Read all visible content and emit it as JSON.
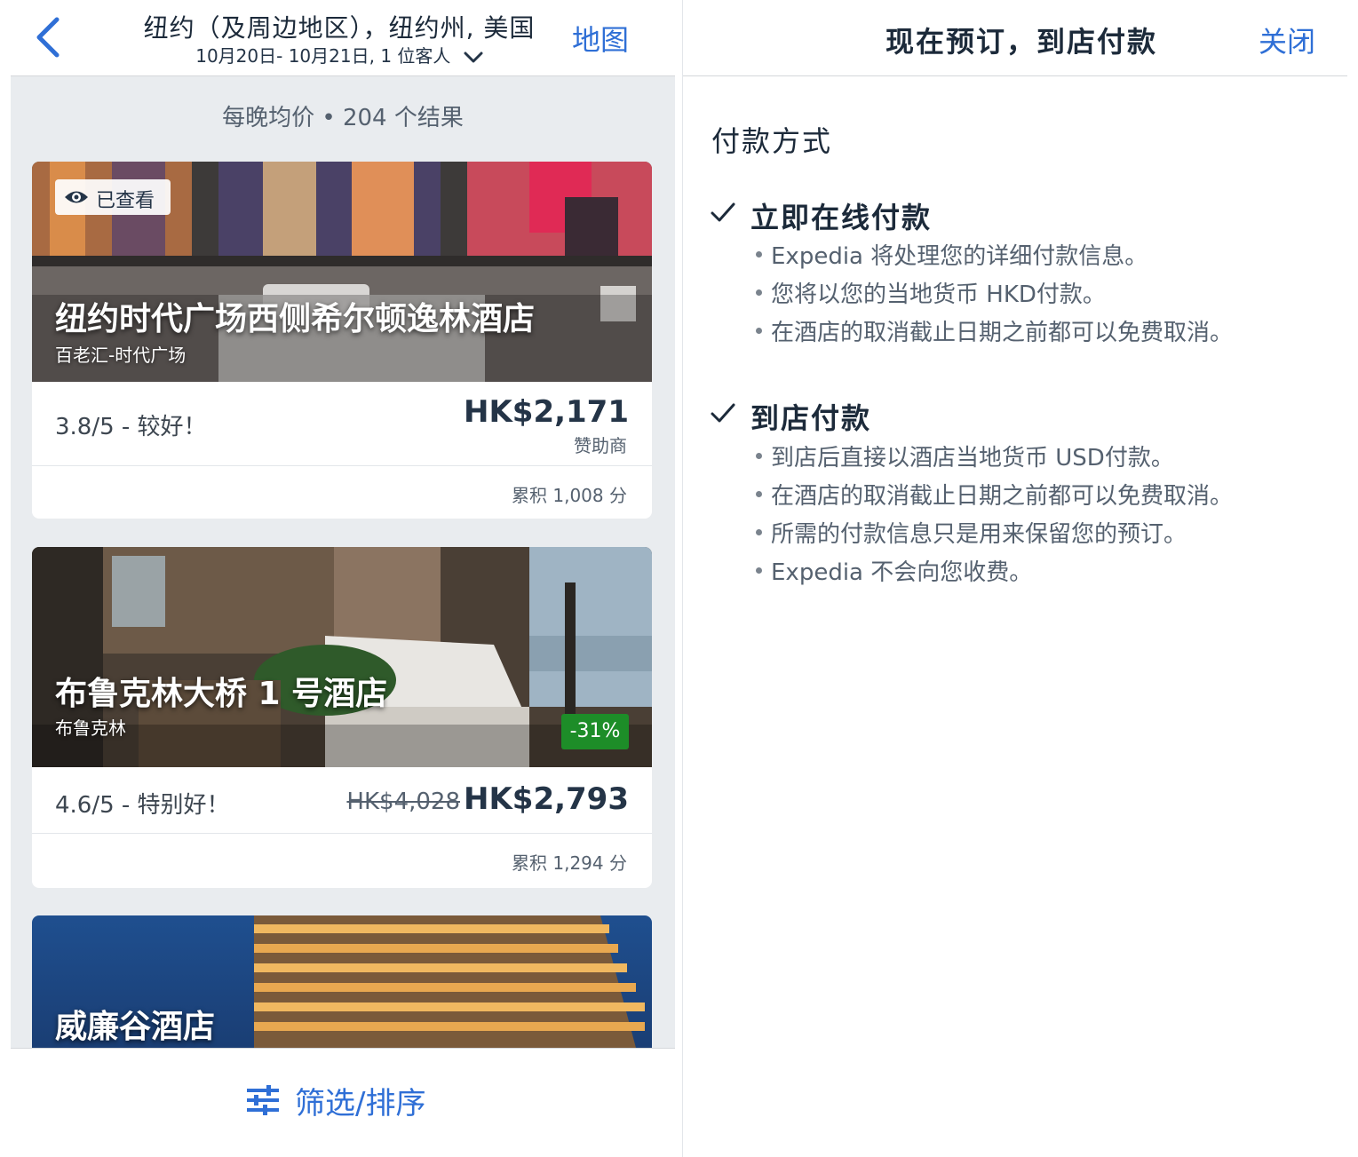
{
  "search_header": {
    "title": "纽约（及周边地区），纽约州, 美国",
    "subtitle": "10月20日- 10月21日, 1 位客人",
    "map_label": "地图"
  },
  "results": {
    "summary": "每晚均价 • 204 个结果"
  },
  "hotels": [
    {
      "name": "纽约时代广场西侧希尔顿逸林酒店",
      "area": "百老汇-时代广场",
      "viewed_label": "已查看",
      "rating": "3.8/5 - 较好！",
      "price": "HK$2,171",
      "price_note": "赞助商",
      "points": "累积 1,008 分"
    },
    {
      "name": "布鲁克林大桥 1 号酒店",
      "area": "布鲁克林",
      "discount": "-31%",
      "rating": "4.6/5 - 特别好！",
      "old_price": "HK$4,028",
      "price": "HK$2,793",
      "points": "累积 1,294 分"
    },
    {
      "name": "威廉谷酒店"
    }
  ],
  "bottom_bar": {
    "filter_label": "筛选/排序"
  },
  "payment_sheet": {
    "title": "现在预订，到店付款",
    "close_label": "关闭",
    "section_title": "付款方式",
    "options": [
      {
        "heading": "立即在线付款",
        "bullets": [
          "Expedia 将处理您的详细付款信息。",
          "您将以您的当地货币 HKD付款。",
          "在酒店的取消截止日期之前都可以免费取消。"
        ]
      },
      {
        "heading": "到店付款",
        "bullets": [
          "到店后直接以酒店当地货币 USD付款。",
          "在酒店的取消截止日期之前都可以免费取消。",
          "所需的付款信息只是用来保留您的预订。",
          "Expedia 不会向您收费。"
        ]
      }
    ]
  },
  "colors": {
    "accent_blue": "#2f6fd6",
    "discount_green": "#1d8d28",
    "list_background": "#e9ecef",
    "text_dark": "#243447"
  },
  "icons": [
    "back-chevron-icon",
    "chevron-down-icon",
    "eye-icon",
    "filter-sliders-icon",
    "checkmark-icon"
  ]
}
